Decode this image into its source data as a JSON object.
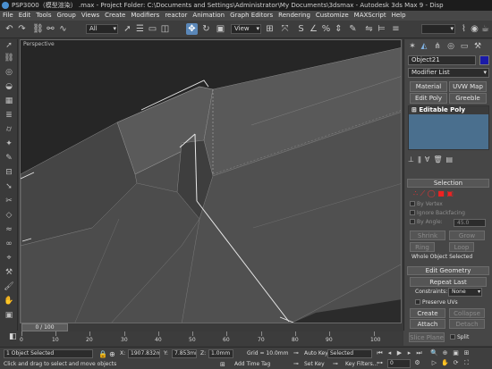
{
  "window": {
    "title": "PSP3000（模型渲染） .max  - Project Folder: C:\\Documents and Settings\\Administrator\\My Documents\\3dsmax  - Autodesk 3ds Max 9  - Disp"
  },
  "menu": [
    "File",
    "Edit",
    "Tools",
    "Group",
    "Views",
    "Create",
    "Modifiers",
    "reactor",
    "Animation",
    "Graph Editors",
    "Rendering",
    "Customize",
    "MAXScript",
    "Help"
  ],
  "toolbar": {
    "selection_filter": "All",
    "ref_coord": "View",
    "named_selection": ""
  },
  "viewport": {
    "label": "Perspective"
  },
  "command_panel": {
    "object_name": "Object21",
    "object_color": "#1a1aa8",
    "modifier_list": "Modifier List",
    "mod_buttons": [
      "Material",
      "UVW Map",
      "Edit Poly",
      "Greeble"
    ],
    "stack_item": "Editable Poly",
    "selection": {
      "title": "Selection",
      "by_vertex": "By Vertex",
      "ignore_backfacing": "Ignore Backfacing",
      "by_angle": "By Angle:",
      "angle_value": "45.0",
      "shrink": "Shrink",
      "grow": "Grow",
      "ring": "Ring",
      "loop": "Loop",
      "status": "Whole Object Selected"
    },
    "edit_geometry": {
      "title": "Edit Geometry",
      "repeat_last": "Repeat Last",
      "constraints_label": "Constraints:",
      "constraints_value": "None",
      "preserve_uvs": "Preserve UVs",
      "create": "Create",
      "collapse": "Collapse",
      "attach": "Attach",
      "detach": "Detach",
      "slice_plane": "Slice Plane",
      "split": "Split"
    }
  },
  "timeline": {
    "slider": "0 / 100",
    "ticks": [
      "0",
      "10",
      "20",
      "30",
      "40",
      "50",
      "60",
      "70",
      "80",
      "90",
      "100"
    ]
  },
  "status": {
    "selection": "1 Object Selected",
    "prompt": "Click and drag to select and move objects",
    "x_label": "X:",
    "x_value": "1907.832m",
    "y_label": "Y:",
    "y_value": "7.853mm",
    "z_label": "Z:",
    "z_value": "1.0mm",
    "grid": "Grid = 10.0mm",
    "add_time_tag": "Add Time Tag",
    "auto_key": "Auto Key",
    "set_key": "Set Key",
    "key_mode": "Selected",
    "key_filters": "Key Filters...",
    "frame": "0"
  }
}
